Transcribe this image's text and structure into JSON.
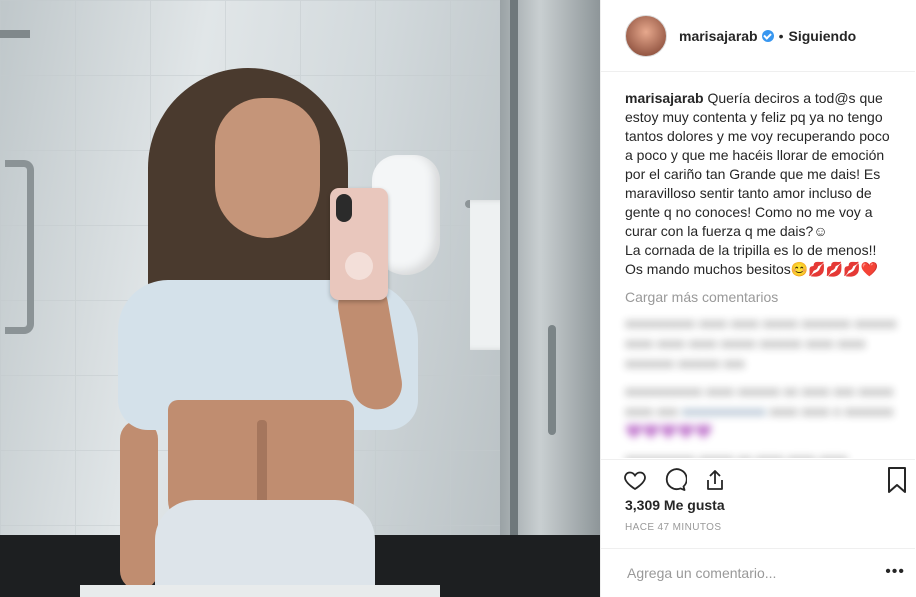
{
  "header": {
    "username": "marisajarab",
    "separator": "•",
    "follow_status": "Siguiendo"
  },
  "caption": {
    "username": "marisajarab",
    "text": "Quería deciros a tod@s que estoy muy contenta y feliz pq ya no tengo tantos dolores y me voy recuperando poco a poco y que me hacéis llorar de emoción por el cariño tan Grande que me dais! Es maravilloso sentir tanto amor incluso de gente q no conoces! Como no me voy a curar con la fuerza q me dais?☺\nLa cornada de la tripilla es lo de menos!!\nOs mando muchos besitos😊💋💋💋❤️"
  },
  "comments": {
    "load_more": "Cargar más comentarios"
  },
  "likes": "3,309 Me gusta",
  "timestamp": "HACE 47 MINUTOS",
  "add_comment": {
    "placeholder": "Agrega un comentario...",
    "more": "•••"
  },
  "colors": {
    "verified": "#3897f0",
    "link": "#003569",
    "muted": "#999999"
  },
  "icons": [
    "heart-icon",
    "comment-icon",
    "share-icon",
    "bookmark-icon",
    "verified-icon",
    "more-icon"
  ]
}
